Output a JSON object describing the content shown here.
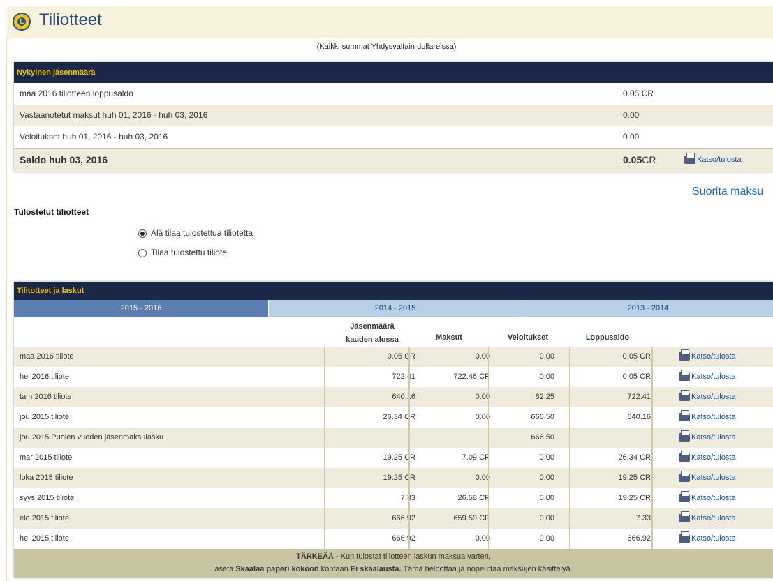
{
  "header": {
    "title": "Tiliotteet"
  },
  "note": "(Kaikki summat Yhdysvaltain dollareissa)",
  "membership": {
    "heading": "Nykyinen jäsenmäärä",
    "rows": [
      {
        "label": "maa 2016 tiliotteen loppusaldo",
        "amount": "0.05 CR"
      },
      {
        "label": "Vastaanotetut maksut huh 01, 2016 - huh 03, 2016",
        "amount": "0.00"
      },
      {
        "label": "Veloitukset huh 01, 2016 - huh 03, 2016",
        "amount": "0.00"
      }
    ],
    "balance": {
      "label": "Saldo huh 03, 2016",
      "amount": "0.05",
      "suffix": "CR",
      "link": "Katso/tulosta"
    }
  },
  "pay_link": "Suorita maksu",
  "printed": {
    "heading": "Tulostetut tiliotteet",
    "options": [
      {
        "label": "Älä tilaa tulostettua tiliotetta",
        "selected": true
      },
      {
        "label": "Tilaa tulostettu tiliote",
        "selected": false
      }
    ]
  },
  "statements": {
    "heading": "Tilitotteet ja laskut",
    "tabs": [
      "2015 - 2016",
      "2014 - 2015",
      "2013 - 2014"
    ],
    "columns": {
      "start_line1": "Jäsenmäärä",
      "start_line2": "kauden alussa",
      "payments": "Maksut",
      "charges": "Veloitukset",
      "end": "Loppusaldo"
    },
    "rows": [
      {
        "label": "maa 2016 tiliote",
        "start": "0.05 CR",
        "payments": "0.00",
        "charges": "0.00",
        "end": "0.05 CR",
        "link": "Katso/tulosta"
      },
      {
        "label": "hel 2016 tiliote",
        "start": "722.41",
        "payments": "722.46 CR",
        "charges": "0.00",
        "end": "0.05 CR",
        "link": "Katso/tulosta"
      },
      {
        "label": "tam 2016 tiliote",
        "start": "640.16",
        "payments": "0.00",
        "charges": "82.25",
        "end": "722.41",
        "link": "Katso/tulosta"
      },
      {
        "label": "jou 2015 tiliote",
        "start": "26.34 CR",
        "payments": "0.00",
        "charges": "666.50",
        "end": "640.16",
        "link": "Katso/tulosta"
      },
      {
        "label": "jou 2015 Puolen vuoden jäsenmaksulasku",
        "start": "",
        "payments": "",
        "charges": "666.50",
        "end": "",
        "link": "Katso/tulosta"
      },
      {
        "label": "mar 2015 tiliote",
        "start": "19.25 CR",
        "payments": "7.09 CR",
        "charges": "0.00",
        "end": "26.34 CR",
        "link": "Katso/tulosta"
      },
      {
        "label": "loka 2015 tiliote",
        "start": "19.25 CR",
        "payments": "0.00",
        "charges": "0.00",
        "end": "19.25 CR",
        "link": "Katso/tulosta"
      },
      {
        "label": "syys 2015 tiliote",
        "start": "7.33",
        "payments": "26.58 CR",
        "charges": "0.00",
        "end": "19.25 CR",
        "link": "Katso/tulosta"
      },
      {
        "label": "elo 2015 tiliote",
        "start": "666.92",
        "payments": "659.59 CR",
        "charges": "0.00",
        "end": "7.33",
        "link": "Katso/tulosta"
      },
      {
        "label": "hei 2015 tiliote",
        "start": "666.92",
        "payments": "0.00",
        "charges": "0.00",
        "end": "666.92",
        "link": "Katso/tulosta"
      }
    ],
    "footer": {
      "line1_bold": "TÄRKEÄÄ",
      "line1_rest": " - Kun tulostat tiliotteen laskun maksua varten,",
      "line2_a": "aseta ",
      "line2_b": "Skaalaa paperi kokoon",
      "line2_c": " kohtaan ",
      "line2_d": "Ei skaalausta.",
      "line2_e": " Tämä helpottaa ja nopeuttaa maksujen käsittelyä."
    }
  }
}
